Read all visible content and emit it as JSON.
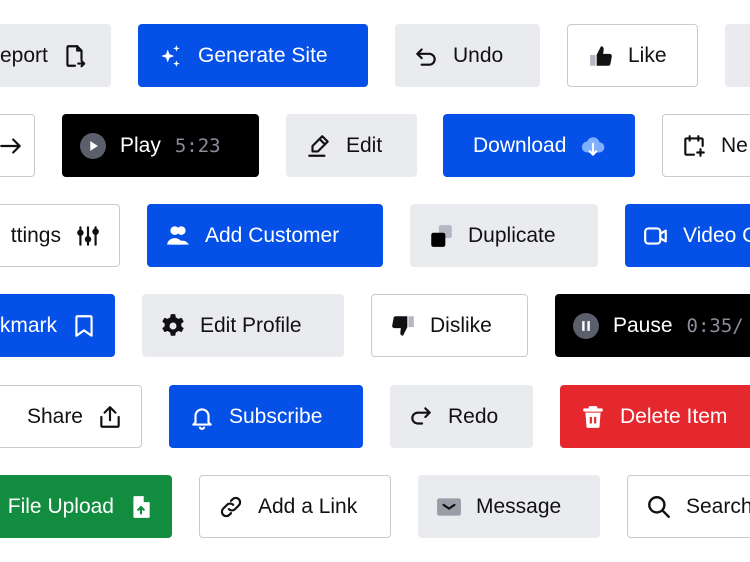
{
  "colors": {
    "primary_blue": "#0550e6",
    "neutral_gray": "#eaebef",
    "outline_border": "#c9cbd1",
    "black": "#000000",
    "danger_red": "#e5282e",
    "success_green": "#128c3e",
    "timestamp_gray": "#8a8d99"
  },
  "buttons": {
    "report": {
      "label": "eport",
      "icon": "file-export-icon"
    },
    "generate_site": {
      "label": "Generate Site",
      "icon": "sparkles-icon"
    },
    "undo": {
      "label": "Undo",
      "icon": "undo-icon"
    },
    "like": {
      "label": "Like",
      "icon": "thumbs-up-icon"
    },
    "arrow": {
      "icon": "arrow-right-icon"
    },
    "play": {
      "label": "Play",
      "time": "5:23",
      "icon": "play-icon"
    },
    "edit": {
      "label": "Edit",
      "icon": "pencil-icon"
    },
    "download": {
      "label": "Download",
      "icon": "cloud-download-icon"
    },
    "new": {
      "label": "Ne",
      "icon": "calendar-plus-icon"
    },
    "settings": {
      "label": "ttings",
      "icon": "sliders-icon"
    },
    "add_customer": {
      "label": "Add Customer",
      "icon": "users-icon"
    },
    "duplicate": {
      "label": "Duplicate",
      "icon": "duplicate-icon"
    },
    "video": {
      "label": "Video C",
      "icon": "video-icon"
    },
    "bookmark": {
      "label": "kmark",
      "icon": "bookmark-icon"
    },
    "edit_profile": {
      "label": "Edit Profile",
      "icon": "gear-icon"
    },
    "dislike": {
      "label": "Dislike",
      "icon": "thumbs-down-icon"
    },
    "pause": {
      "label": "Pause",
      "time": "0:35/",
      "icon": "pause-icon"
    },
    "share": {
      "label": "Share",
      "icon": "share-upload-icon"
    },
    "subscribe": {
      "label": "Subscribe",
      "icon": "bell-icon"
    },
    "redo": {
      "label": "Redo",
      "icon": "redo-icon"
    },
    "delete_item": {
      "label": "Delete Item",
      "icon": "trash-icon"
    },
    "file_upload": {
      "label": "File Upload",
      "icon": "file-upload-icon"
    },
    "add_link": {
      "label": "Add a Link",
      "icon": "link-icon"
    },
    "message": {
      "label": "Message",
      "icon": "mail-icon"
    },
    "search": {
      "label": "Search",
      "icon": "search-icon"
    }
  }
}
